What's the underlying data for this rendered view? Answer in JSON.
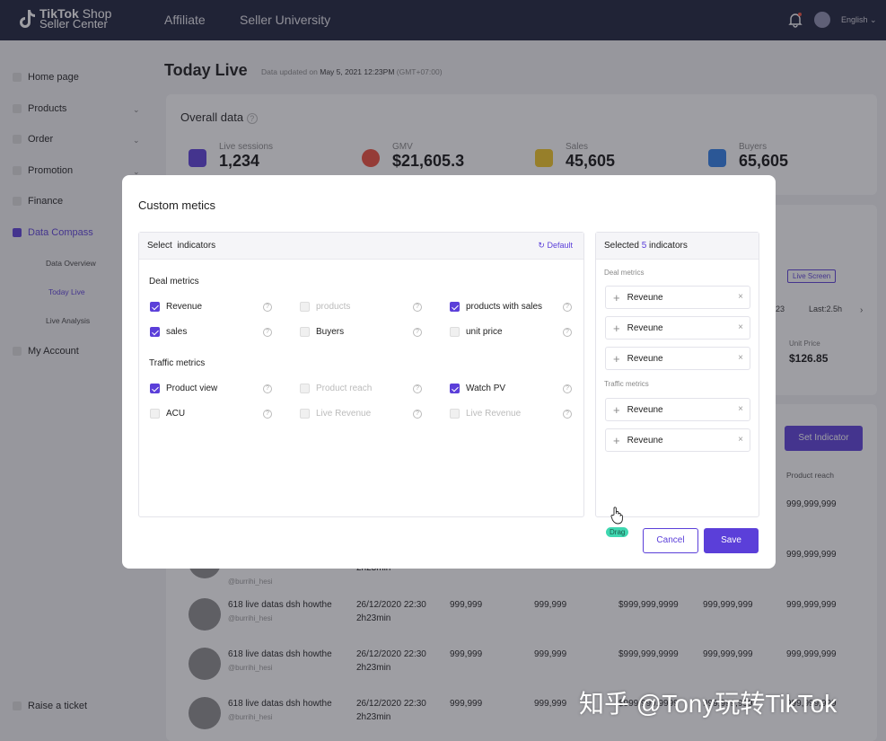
{
  "header": {
    "logo_line1": "TikTok",
    "logo_line1b": "Shop",
    "logo_line2": "Seller Center",
    "nav": [
      "Affiliate",
      "Seller University"
    ],
    "language": "English"
  },
  "sidebar": {
    "items": [
      "Home page",
      "Products",
      "Order",
      "Promotion",
      "Finance",
      "Data Compass",
      "My Account"
    ],
    "sub_items": [
      "Data Overview",
      "Today Live",
      "Live Analysis"
    ],
    "raise_ticket": "Raise a ticket"
  },
  "page": {
    "title": "Today Live",
    "updated_prefix": "Data updated on ",
    "updated_date": "May 5, 2021 12:23PM",
    "updated_tz": " (GMT+07:00)",
    "overall_title": "Overall data"
  },
  "stats": [
    {
      "label": "Live sessions",
      "value": "1,234",
      "color": "#5b3fd9"
    },
    {
      "label": "GMV",
      "value": "$21,605.3",
      "color": "#ee4d3b"
    },
    {
      "label": "Sales",
      "value": "45,605",
      "color": "#f3c623"
    },
    {
      "label": "Buyers",
      "value": "65,605",
      "color": "#2f7fe8"
    }
  ],
  "background_panel": {
    "live_screen": "Live Screen",
    "time_a": "23",
    "last": "Last:2.5h",
    "unit_price_label": "Unit Price",
    "unit_price_value": "$126.85",
    "set_indicator": "Set Indicator",
    "product_reach": "Product reach",
    "reach_values": [
      "999,999,999",
      "999,999,999"
    ],
    "partial_handle": "@burrihi_hesi",
    "partial_time": "2h23min"
  },
  "table_rows": [
    {
      "name": "618 live datas dsh howthe",
      "handle": "@burrihi_hesi",
      "date": "26/12/2020 22:30",
      "dur": "2h23min",
      "c1": "999,999",
      "c2": "999,999",
      "c3": "$999,999,9999",
      "c4": "999,999,999",
      "c5": "999,999,999"
    },
    {
      "name": "618 live datas dsh howthe",
      "handle": "@burrihi_hesi",
      "date": "26/12/2020 22:30",
      "dur": "2h23min",
      "c1": "999,999",
      "c2": "999,999",
      "c3": "$999,999,9999",
      "c4": "999,999,999",
      "c5": "999,999,999"
    },
    {
      "name": "618 live datas dsh howthe",
      "handle": "@burrihi_hesi",
      "date": "26/12/2020 22:30",
      "dur": "2h23min",
      "c1": "999,999",
      "c2": "999,999",
      "c3": "$999,999,9999",
      "c4": "999,999,999",
      "c5": "999,999,999"
    }
  ],
  "modal": {
    "title": "Custom metics",
    "select_head": "Select  indicators",
    "default_label": "Default",
    "deal_title": "Deal metrics",
    "traffic_title": "Traffic metrics",
    "deal_options": [
      {
        "label": "Revenue",
        "checked": true,
        "disabled": false
      },
      {
        "label": "products",
        "checked": false,
        "disabled": true
      },
      {
        "label": "products with sales",
        "checked": true,
        "disabled": false
      },
      {
        "label": "sales",
        "checked": true,
        "disabled": false
      },
      {
        "label": "Buyers",
        "checked": false,
        "disabled": false
      },
      {
        "label": "unit price",
        "checked": false,
        "disabled": false
      }
    ],
    "traffic_options": [
      {
        "label": "Product view",
        "checked": true,
        "disabled": false
      },
      {
        "label": "Product reach",
        "checked": false,
        "disabled": true
      },
      {
        "label": "Watch PV",
        "checked": true,
        "disabled": false
      },
      {
        "label": "ACU",
        "checked": false,
        "disabled": false
      },
      {
        "label": "Live Revenue",
        "checked": false,
        "disabled": true
      },
      {
        "label": "Live Revenue",
        "checked": false,
        "disabled": true
      }
    ],
    "selected_prefix": "Selected ",
    "selected_count": "5",
    "selected_suffix": " indicators",
    "selected_deal_label": "Deal metrics",
    "selected_traffic_label": "Traffic metrics",
    "selected_deal": [
      "Reveune",
      "Reveune",
      "Reveune"
    ],
    "selected_traffic": [
      "Reveune",
      "Reveune"
    ],
    "drag_label": "Drag",
    "cancel": "Cancel",
    "save": "Save"
  },
  "watermark": "知乎 @Tony玩转TikTok",
  "colors": {
    "accent": "#5b3fd9",
    "topbar": "#1b1f3a"
  }
}
